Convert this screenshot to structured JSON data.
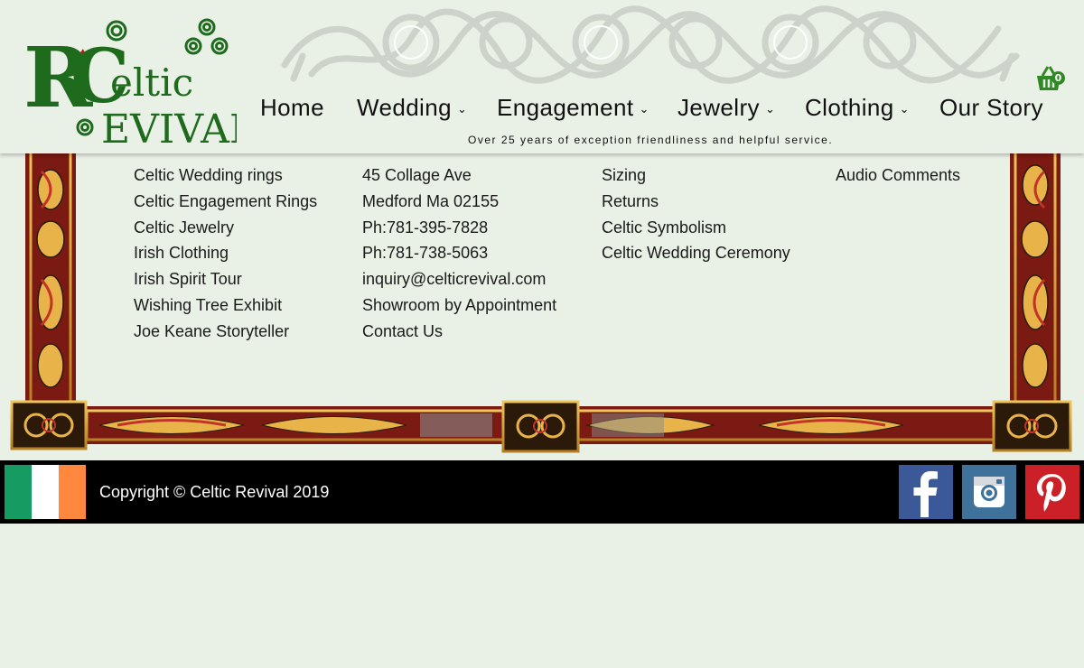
{
  "site": {
    "name": "Celtic Revival",
    "tagline": "Over 25 years of exception friendliness and helpful service."
  },
  "cart": {
    "count": "0",
    "icon": "basket-icon"
  },
  "nav": [
    {
      "label": "Home",
      "dropdown": false
    },
    {
      "label": "Wedding",
      "dropdown": true
    },
    {
      "label": "Engagement",
      "dropdown": true
    },
    {
      "label": "Jewelry",
      "dropdown": true
    },
    {
      "label": "Clothing",
      "dropdown": true
    },
    {
      "label": "Our Story",
      "dropdown": false
    }
  ],
  "dropdown_caret": "⌄",
  "footer": {
    "col1": [
      "Celtic Wedding rings",
      "Celtic Engagement Rings",
      "Celtic Jewelry",
      "Irish Clothing",
      "Irish Spirit Tour",
      "Wishing Tree Exhibit",
      "Joe Keane Storyteller"
    ],
    "col2": [
      "45 Collage Ave",
      "Medford Ma 02155",
      "Ph:781-395-7828",
      "Ph:781-738-5063",
      "inquiry@celticrevival.com",
      "Showroom by Appointment",
      "Contact Us"
    ],
    "col3": [
      "Sizing",
      "Returns",
      "Celtic Symbolism",
      "Celtic Wedding Ceremony"
    ],
    "col4": [
      "Audio Comments"
    ]
  },
  "copyright": "Copyright © Celtic Revival 2019",
  "social": [
    {
      "name": "facebook",
      "icon": "facebook-icon",
      "color": "#3b5998"
    },
    {
      "name": "instagram",
      "icon": "instagram-icon",
      "color": "#3f729b"
    },
    {
      "name": "pinterest",
      "icon": "pinterest-icon",
      "color": "#cb2027"
    }
  ],
  "colors": {
    "background": "#e9f0e6",
    "logo_green": "#1e6b1e",
    "frame_red": "#7b1a12",
    "frame_gold": "#d9a23a",
    "flag_green": "#169b62",
    "flag_white": "#ffffff",
    "flag_orange": "#ff883e"
  }
}
